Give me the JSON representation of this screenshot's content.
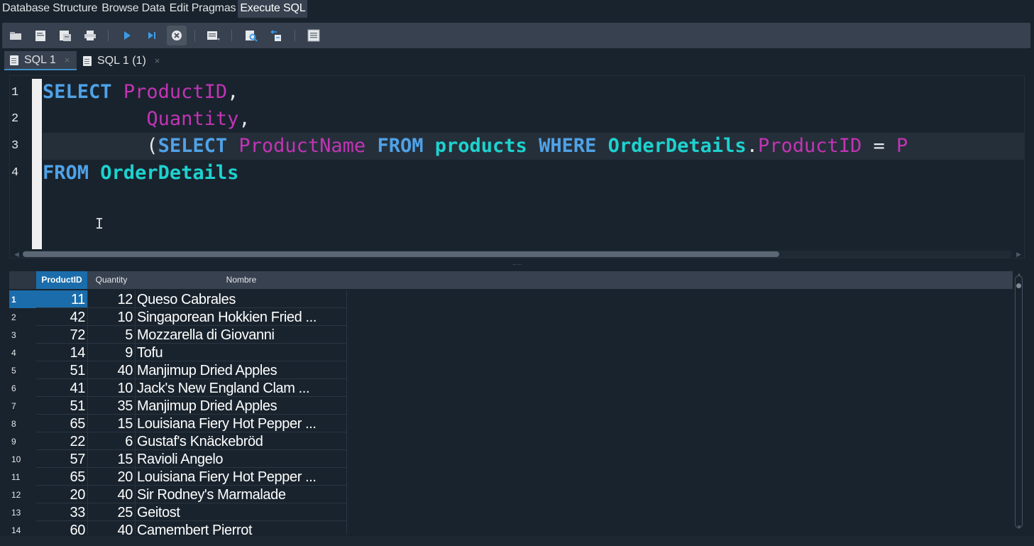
{
  "main_tabs": [
    {
      "label": "Database Structure",
      "active": false
    },
    {
      "label": "Browse Data",
      "active": false
    },
    {
      "label": "Edit Pragmas",
      "active": false
    },
    {
      "label": "Execute SQL",
      "active": true
    }
  ],
  "toolbar": {
    "buttons": [
      {
        "icon": "open-tab-icon"
      },
      {
        "icon": "open-sql-file-icon"
      },
      {
        "icon": "save-sql-file-icon"
      },
      {
        "icon": "print-icon"
      },
      {
        "icon": "execute-all-icon"
      },
      {
        "icon": "execute-current-line-icon"
      },
      {
        "icon": "stop-execution-icon"
      },
      {
        "icon": "save-results-icon"
      },
      {
        "icon": "find-icon"
      },
      {
        "icon": "find-replace-icon"
      },
      {
        "icon": "toggle-comment-icon"
      }
    ]
  },
  "editor_tabs": [
    {
      "label": "SQL 1",
      "close": "×",
      "active": true
    },
    {
      "label": "SQL 1 (1)",
      "close": "×",
      "active": false
    }
  ],
  "editor": {
    "line_numbers": [
      "1",
      "2",
      "3",
      "4"
    ],
    "current_line": 3,
    "lines": [
      [
        {
          "t": "SELECT",
          "c": "kw"
        },
        {
          "t": " ",
          "c": "punc"
        },
        {
          "t": "ProductID",
          "c": "fld"
        },
        {
          "t": ",",
          "c": "punc"
        }
      ],
      [
        {
          "t": "         ",
          "c": "punc"
        },
        {
          "t": "Quantity",
          "c": "fld"
        },
        {
          "t": ",",
          "c": "punc"
        }
      ],
      [
        {
          "t": "         (",
          "c": "punc"
        },
        {
          "t": "SELECT",
          "c": "kw"
        },
        {
          "t": " ",
          "c": "punc"
        },
        {
          "t": "ProductName",
          "c": "fld"
        },
        {
          "t": " ",
          "c": "punc"
        },
        {
          "t": "FROM",
          "c": "kw"
        },
        {
          "t": " ",
          "c": "punc"
        },
        {
          "t": "products",
          "c": "tbl"
        },
        {
          "t": " ",
          "c": "punc"
        },
        {
          "t": "WHERE",
          "c": "kw"
        },
        {
          "t": " ",
          "c": "punc"
        },
        {
          "t": "OrderDetails",
          "c": "tbl"
        },
        {
          "t": ".",
          "c": "punc"
        },
        {
          "t": "ProductID",
          "c": "fld"
        },
        {
          "t": " = ",
          "c": "punc"
        },
        {
          "t": "P",
          "c": "fld"
        }
      ],
      [
        {
          "t": "FROM",
          "c": "kw"
        },
        {
          "t": " ",
          "c": "punc"
        },
        {
          "t": "OrderDetails",
          "c": "tbl"
        }
      ]
    ],
    "cursor_glyph": "I"
  },
  "results": {
    "columns": [
      "ProductID",
      "Quantity",
      "Nombre"
    ],
    "selected_column": 0,
    "selected_row": 1,
    "rows": [
      {
        "n": "1",
        "product_id": "11",
        "quantity": "12",
        "nombre": "Queso Cabrales"
      },
      {
        "n": "2",
        "product_id": "42",
        "quantity": "10",
        "nombre": "Singaporean Hokkien Fried ..."
      },
      {
        "n": "3",
        "product_id": "72",
        "quantity": "5",
        "nombre": "Mozzarella di Giovanni"
      },
      {
        "n": "4",
        "product_id": "14",
        "quantity": "9",
        "nombre": "Tofu"
      },
      {
        "n": "5",
        "product_id": "51",
        "quantity": "40",
        "nombre": "Manjimup Dried Apples"
      },
      {
        "n": "6",
        "product_id": "41",
        "quantity": "10",
        "nombre": "Jack's New England Clam ..."
      },
      {
        "n": "7",
        "product_id": "51",
        "quantity": "35",
        "nombre": "Manjimup Dried Apples"
      },
      {
        "n": "8",
        "product_id": "65",
        "quantity": "15",
        "nombre": "Louisiana Fiery Hot Pepper ..."
      },
      {
        "n": "9",
        "product_id": "22",
        "quantity": "6",
        "nombre": "Gustaf's Knäckebröd"
      },
      {
        "n": "10",
        "product_id": "57",
        "quantity": "15",
        "nombre": "Ravioli Angelo"
      },
      {
        "n": "11",
        "product_id": "65",
        "quantity": "20",
        "nombre": "Louisiana Fiery Hot Pepper ..."
      },
      {
        "n": "12",
        "product_id": "20",
        "quantity": "40",
        "nombre": "Sir Rodney's Marmalade"
      },
      {
        "n": "13",
        "product_id": "33",
        "quantity": "25",
        "nombre": "Geitost"
      },
      {
        "n": "14",
        "product_id": "60",
        "quantity": "40",
        "nombre": "Camembert Pierrot"
      }
    ]
  },
  "colors": {
    "background": "#19232d",
    "panel": "#37414f",
    "selection": "#1b6cab",
    "keyword": "#4fa2e7",
    "field": "#c234b5",
    "table": "#1dd2cf"
  }
}
